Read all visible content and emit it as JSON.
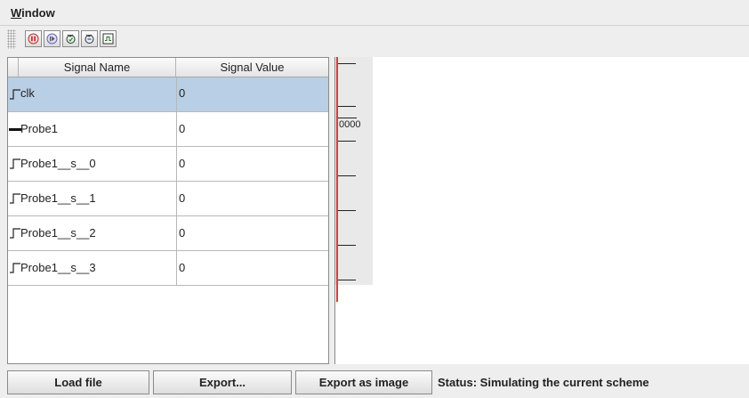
{
  "menu": {
    "window_label": "Window",
    "window_mnemonic": "W",
    "window_rest": "indow"
  },
  "toolbar": {
    "buttons": [
      {
        "name": "pause-icon"
      },
      {
        "name": "resume-icon"
      },
      {
        "name": "step-icon"
      },
      {
        "name": "step-back-icon"
      },
      {
        "name": "waveform-icon"
      }
    ]
  },
  "table": {
    "columns": [
      "Signal Name",
      "Signal Value"
    ],
    "rows": [
      {
        "name": "clk",
        "value": "0",
        "icon": "signal-step-icon",
        "selected": true
      },
      {
        "name": "Probe1",
        "value": "0",
        "icon": "bus-signal-icon",
        "selected": false
      },
      {
        "name": "Probe1__s__0",
        "value": "0",
        "icon": "signal-step-icon",
        "selected": false
      },
      {
        "name": "Probe1__s__1",
        "value": "0",
        "icon": "signal-step-icon",
        "selected": false
      },
      {
        "name": "Probe1__s__2",
        "value": "0",
        "icon": "signal-step-icon",
        "selected": false
      },
      {
        "name": "Probe1__s__3",
        "value": "0",
        "icon": "signal-step-icon",
        "selected": false
      }
    ]
  },
  "wave": {
    "probe_label": "0000"
  },
  "bottom": {
    "load_label": "Load file",
    "export_label": "Export...",
    "export_image_label": "Export as image",
    "status": "Status: Simulating the current scheme"
  },
  "colors": {
    "selected_row": "#b8cfe5",
    "cursor": "#d04040"
  }
}
